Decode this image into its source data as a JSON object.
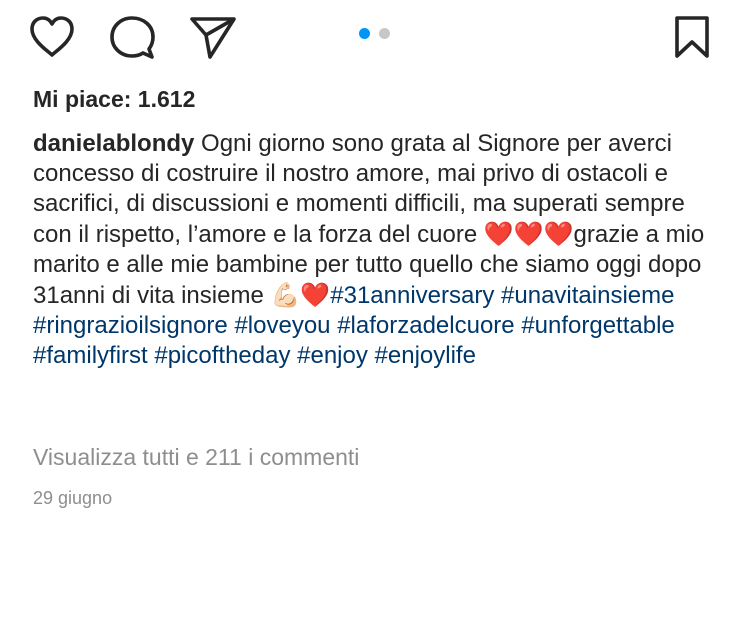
{
  "actions": {
    "like_icon": "heart-outline",
    "comment_icon": "speech-bubble",
    "share_icon": "paper-plane",
    "save_icon": "bookmark-outline"
  },
  "carousel": {
    "total": 2,
    "active_index": 0,
    "active_color": "#0095f6",
    "inactive_color": "#c7c7c7"
  },
  "likes_label": "Mi piace: 1.612",
  "caption": {
    "username": "danielablondy",
    "text_part1": " Ogni giorno sono grata al Signore per averci concesso di costruire il nostro amore, mai privo di ostacoli e sacrifici, di discussioni e momenti difficili, ma superati sempre con il rispetto, l’amore e la forza del cuore ",
    "hearts_1": "❤️❤️❤️",
    "text_part2": "grazie a mio marito e alle mie bambine per tutto quello che siamo oggi dopo 31anni di vita insieme ",
    "arm_emoji": "💪🏻",
    "heart_2": "❤️",
    "hashtags": [
      "#31anniversary",
      "#unavitainsieme",
      "#ringrazioilsignore",
      "#loveyou",
      "#laforzadelcuore",
      "#unforgettable",
      "#familyfirst",
      "#picoftheday",
      "#enjoy",
      "#enjoylife"
    ]
  },
  "view_comments_label": "Visualizza tutti e 211 i commenti",
  "date_label": "29 giugno",
  "colors": {
    "hashtag": "#00376b",
    "muted": "#8e8e8e",
    "text": "#262626"
  }
}
